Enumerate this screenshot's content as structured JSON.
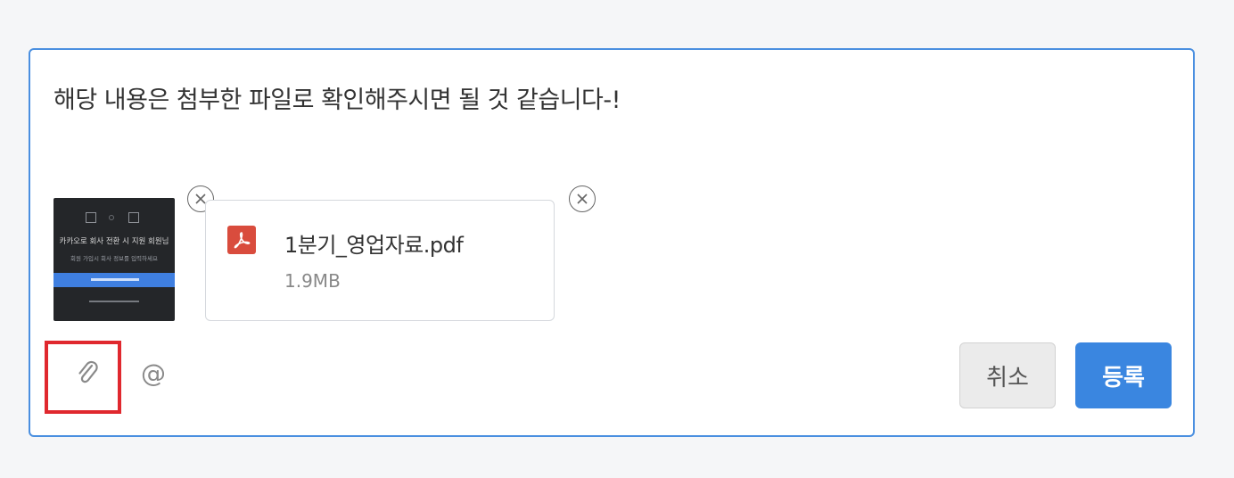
{
  "composer": {
    "message_text": "해당 내용은 첨부한 파일로 확인해주시면 될 것 같습니다-!"
  },
  "attachments": {
    "image": {
      "preview_title": "카카오로 회사 전환 시 지원 회원님",
      "preview_sub": "회원 가입시 회사 정보를 입력하세요",
      "icon": "image-thumbnail"
    },
    "file": {
      "name": "1분기_영업자료.pdf",
      "size": "1.9MB",
      "icon": "pdf-icon"
    }
  },
  "toolbar": {
    "attach_icon": "paperclip-icon",
    "mention_symbol": "@"
  },
  "actions": {
    "cancel_label": "취소",
    "submit_label": "등록"
  },
  "colors": {
    "accent": "#3a86e0",
    "border_focus": "#4a8fe0",
    "highlight": "#e0282e",
    "pdf": "#d94c3d"
  }
}
